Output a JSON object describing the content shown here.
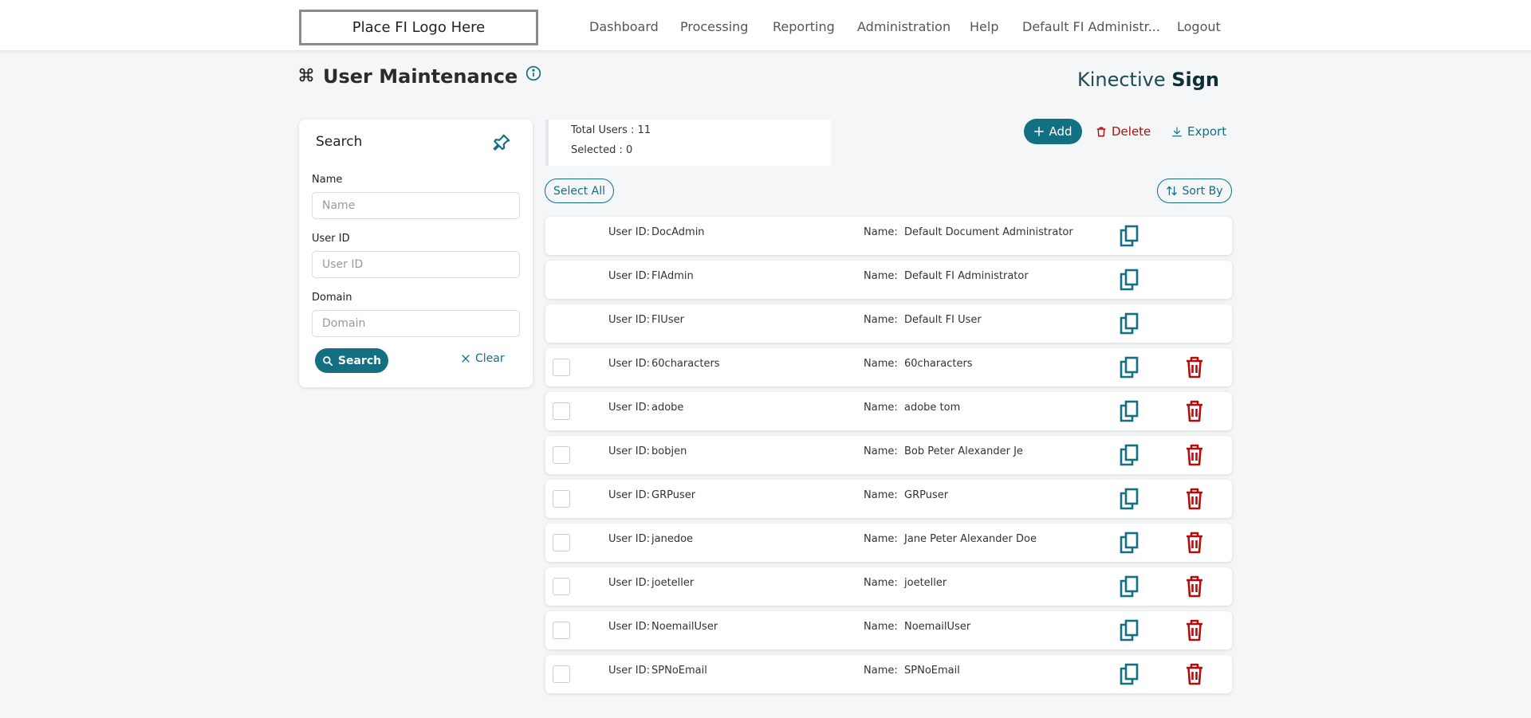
{
  "header": {
    "logo_text": "Place FI Logo Here",
    "nav": [
      {
        "label": "Dashboard"
      },
      {
        "label": "Processing"
      },
      {
        "label": "Reporting"
      },
      {
        "label": "Administration"
      },
      {
        "label": "Help"
      },
      {
        "label": "Default FI Administr..."
      },
      {
        "label": "Logout"
      }
    ]
  },
  "page": {
    "title": "User Maintenance",
    "brand_light": "Kinective",
    "brand_bold": "Sign"
  },
  "search_panel": {
    "title": "Search",
    "name_label": "Name",
    "name_placeholder": "Name",
    "userid_label": "User ID",
    "userid_placeholder": "User ID",
    "domain_label": "Domain",
    "domain_placeholder": "Domain",
    "search_button": "Search",
    "clear_button": "Clear"
  },
  "summary": {
    "total_users": "Total Users : 11",
    "selected": "Selected : 0"
  },
  "toolbar": {
    "add": "Add",
    "delete": "Delete",
    "export": "Export",
    "select_all": "Select All",
    "sort_by": "Sort By"
  },
  "users": {
    "user_id_label": "User ID:",
    "name_label": "Name:",
    "rows": [
      {
        "user_id": "DocAdmin",
        "name": "Default Document Administrator",
        "deletable": false
      },
      {
        "user_id": "FIAdmin",
        "name": "Default FI Administrator",
        "deletable": false
      },
      {
        "user_id": "FIUser",
        "name": "Default FI User",
        "deletable": false
      },
      {
        "user_id": "60characters",
        "name": "60characters",
        "deletable": true
      },
      {
        "user_id": "adobe",
        "name": "adobe tom",
        "deletable": true
      },
      {
        "user_id": "bobjen",
        "name": "Bob Peter Alexander Je",
        "deletable": true
      },
      {
        "user_id": "GRPuser",
        "name": "GRPuser",
        "deletable": true
      },
      {
        "user_id": "janedoe",
        "name": "Jane Peter Alexander Doe",
        "deletable": true
      },
      {
        "user_id": "joeteller",
        "name": "joeteller",
        "deletable": true
      },
      {
        "user_id": "NoemailUser",
        "name": "NoemailUser",
        "deletable": true
      },
      {
        "user_id": "SPNoEmail",
        "name": "SPNoEmail",
        "deletable": true
      }
    ]
  },
  "colors": {
    "accent": "#136f82",
    "danger": "#b30d0d",
    "background": "#f4f6f7"
  }
}
